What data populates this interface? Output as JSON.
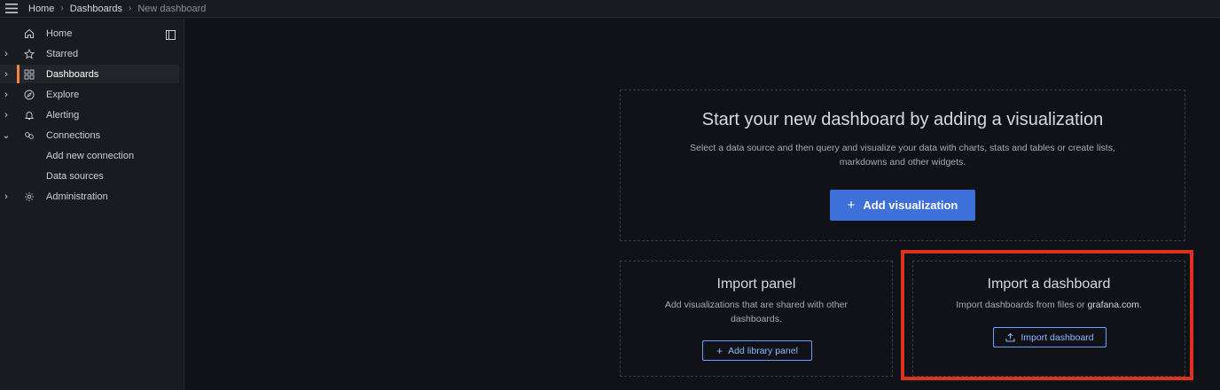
{
  "breadcrumb": {
    "home": "Home",
    "dashboards": "Dashboards",
    "current": "New dashboard",
    "separator": "›"
  },
  "sidebar": {
    "items": [
      {
        "label": "Home",
        "icon": "home-icon",
        "chevron": ""
      },
      {
        "label": "Starred",
        "icon": "star-icon",
        "chevron": "›"
      },
      {
        "label": "Dashboards",
        "icon": "apps-icon",
        "chevron": "›",
        "active": true
      },
      {
        "label": "Explore",
        "icon": "compass-icon",
        "chevron": "›"
      },
      {
        "label": "Alerting",
        "icon": "bell-icon",
        "chevron": "›"
      },
      {
        "label": "Connections",
        "icon": "link-icon",
        "chevron": "⌄"
      },
      {
        "label": "Add new connection",
        "icon": "",
        "chevron": ""
      },
      {
        "label": "Data sources",
        "icon": "",
        "chevron": ""
      },
      {
        "label": "Administration",
        "icon": "gear-icon",
        "chevron": "›"
      }
    ]
  },
  "main": {
    "visualization": {
      "title": "Start your new dashboard by adding a visualization",
      "desc_line1": "Select a data source and then query and visualize your data with charts, stats and tables or create lists,",
      "desc_line2": "markdowns and other widgets.",
      "button_icon": "+",
      "button_label": "Add visualization"
    },
    "import_panel": {
      "title": "Import panel",
      "desc_line1": "Add visualizations that are shared with other",
      "desc_line2": "dashboards.",
      "button_icon": "+",
      "button_label": "Add library panel"
    },
    "import_dashboard": {
      "title": "Import a dashboard",
      "desc_prefix": "Import dashboards from files or ",
      "desc_link": "grafana.com",
      "desc_suffix": ".",
      "button_label": "Import dashboard"
    }
  },
  "colors": {
    "accent": "#3d71d9",
    "active_bar": "#ff7f3f",
    "highlight": "#e0301e"
  }
}
